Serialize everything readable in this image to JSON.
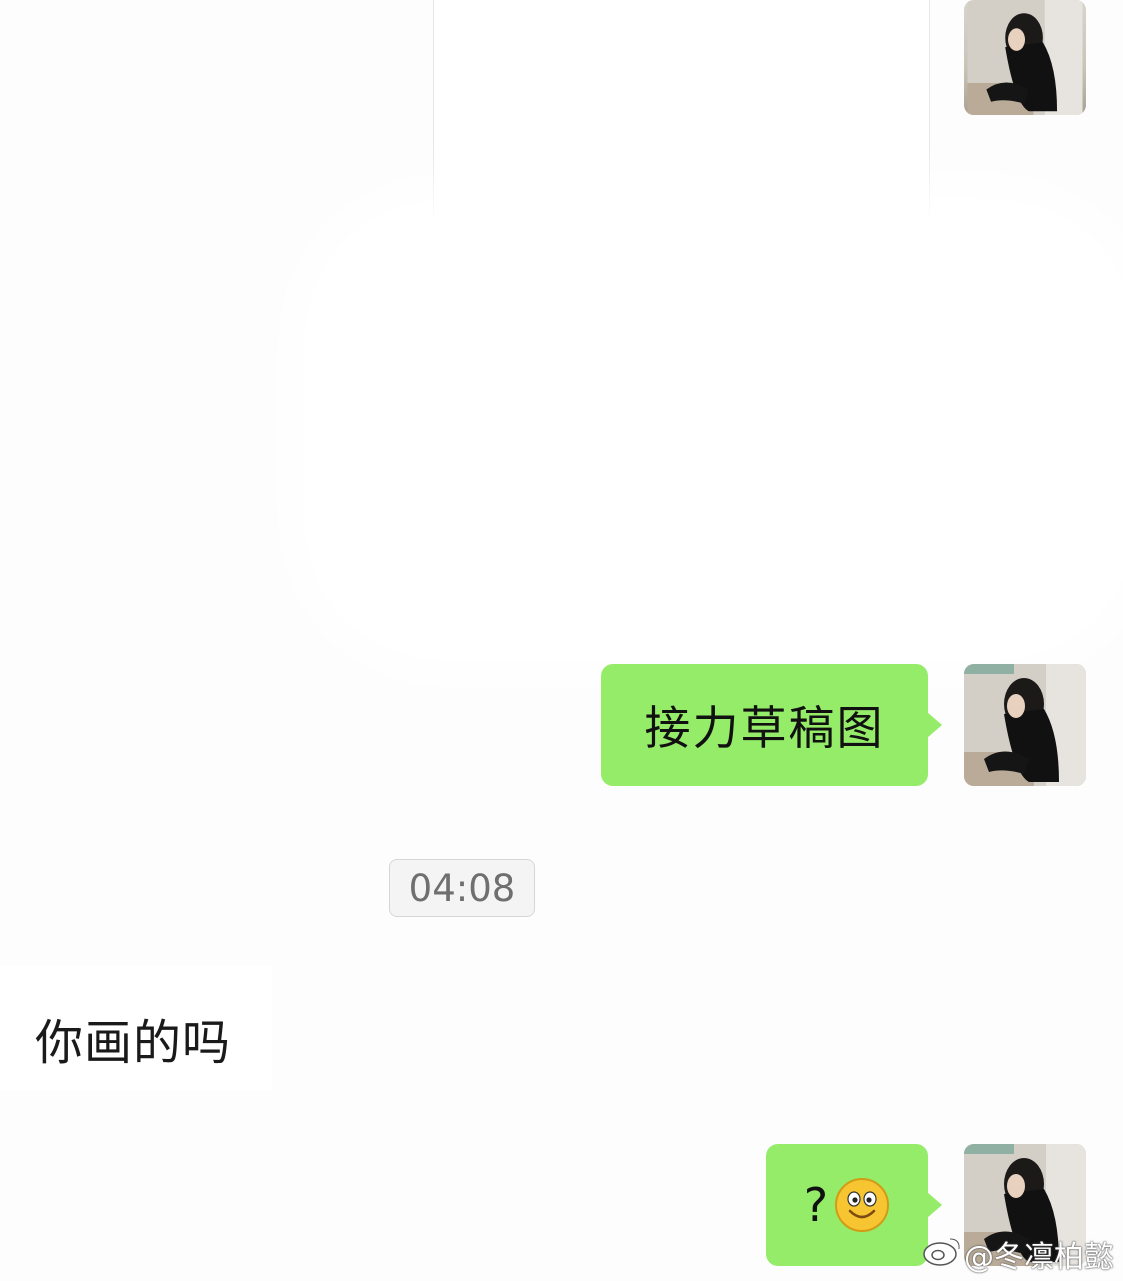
{
  "messages": {
    "outgoing_1": "接力草稿图",
    "timestamp": "04:08",
    "incoming_1": "你画的吗",
    "outgoing_2_text": "?",
    "outgoing_2_emoji": "smile-emoji"
  },
  "watermark": {
    "text": "@冬凛柏懿",
    "icon": "weibo-icon"
  },
  "colors": {
    "outgoing_bubble": "#95ec69",
    "timestamp_bg": "#f4f4f4",
    "background": "#fdfdfd"
  }
}
